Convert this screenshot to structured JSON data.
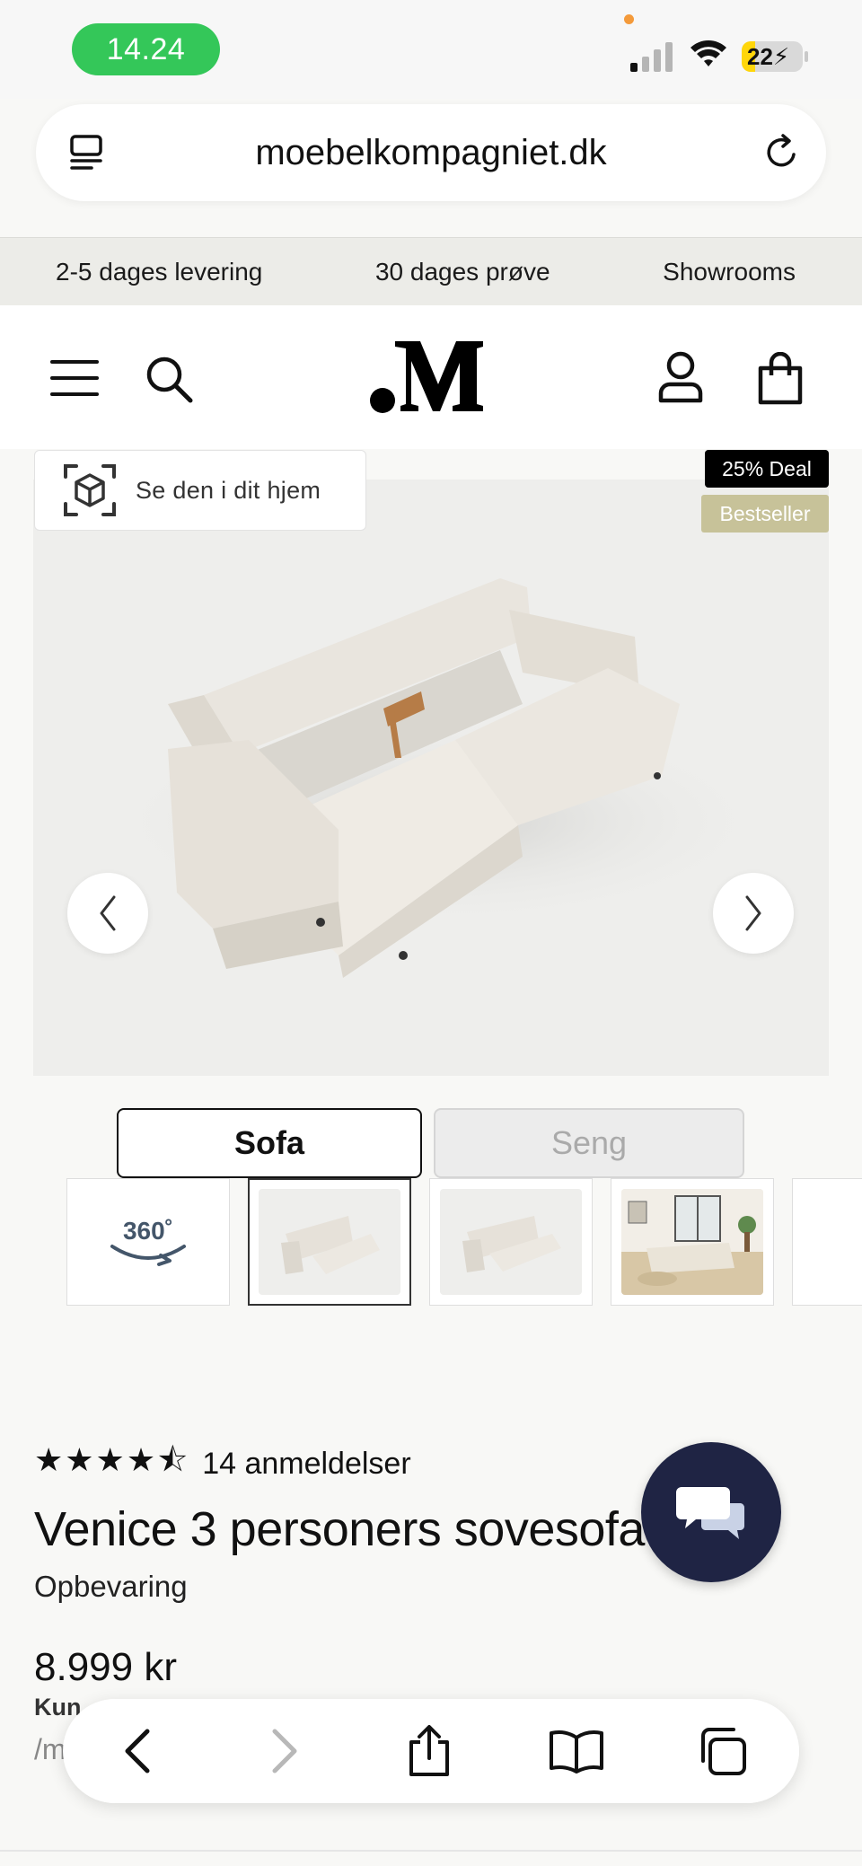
{
  "status_bar": {
    "time": "14.24",
    "battery": "22",
    "battery_level": 0.22,
    "icons": [
      "signal-icon",
      "wifi-icon",
      "battery-charging-icon"
    ]
  },
  "browser": {
    "url": "moebelkompagniet.dk",
    "icons": [
      "reader-menu-icon",
      "reload-icon"
    ]
  },
  "promo_bar": {
    "items": [
      "2-5 dages levering",
      "30 dages prøve",
      "Showrooms"
    ]
  },
  "header": {
    "icons": [
      "menu-icon",
      "search-icon",
      "brand-logo",
      "account-icon",
      "cart-bag-icon"
    ]
  },
  "gallery": {
    "ar_button_label": "Se den i dit hjem",
    "badges": [
      "25% Deal",
      "Bestseller"
    ],
    "badge_colors": {
      "deal": "#000000",
      "bestseller": "#c7c299"
    },
    "icons": [
      "ar-cube-icon",
      "chevron-left-icon",
      "chevron-right-icon"
    ]
  },
  "variants": {
    "options": [
      "Sofa",
      "Seng"
    ],
    "selected": "Sofa"
  },
  "thumbnails": {
    "rotation_label": "360˚",
    "items": [
      "360-view-thumb",
      "sofa-bed-open-thumb",
      "sofa-bed-open-angle-thumb",
      "living-room-thumb"
    ],
    "selected_index": 1
  },
  "product": {
    "stars": "★★★★⯪",
    "rating": 4.5,
    "reviews": "14 anmeldelser",
    "title": "Venice 3 personers sovesofa",
    "subtitle": "Opbevaring",
    "price": "8.999 kr",
    "partial_line_1": "Kun",
    "partial_line_2": "/m"
  },
  "chat": {
    "icon": "chat-bubbles-icon",
    "color": "#1f2444"
  },
  "bottom_toolbar": {
    "icons": [
      "back-icon",
      "forward-icon",
      "share-icon",
      "bookmarks-icon",
      "tabs-icon"
    ]
  }
}
